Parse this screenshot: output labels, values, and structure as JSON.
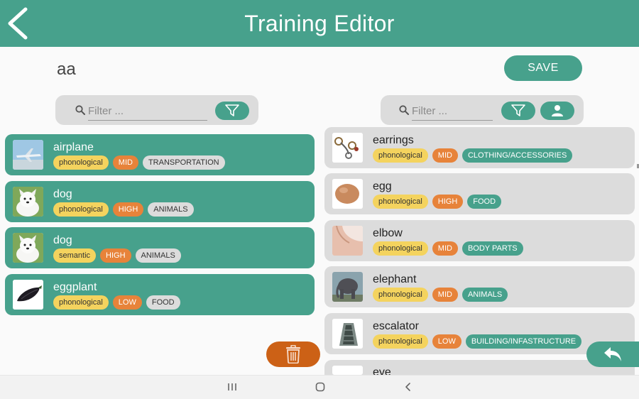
{
  "theme": {
    "teal": "#47a18c",
    "yellow": "#f4d35e",
    "orange": "#e7833a",
    "trash": "#cc6116"
  },
  "header": {
    "title": "Training Editor",
    "back_icon": "chevron-left-icon"
  },
  "training": {
    "name": "aa"
  },
  "toolbar": {
    "save_label": "SAVE"
  },
  "left_panel": {
    "filter_placeholder": "Filter ...",
    "items": [
      {
        "word": "airplane",
        "type": "phonological",
        "level": "MID",
        "category": "TRANSPORTATION"
      },
      {
        "word": "dog",
        "type": "phonological",
        "level": "HIGH",
        "category": "ANIMALS"
      },
      {
        "word": "dog",
        "type": "semantic",
        "level": "HIGH",
        "category": "ANIMALS"
      },
      {
        "word": "eggplant",
        "type": "phonological",
        "level": "LOW",
        "category": "FOOD"
      }
    ]
  },
  "right_panel": {
    "filter_placeholder": "Filter ...",
    "items": [
      {
        "word": "earrings",
        "type": "phonological",
        "level": "MID",
        "category": "CLOTHING/ACCESSORIES"
      },
      {
        "word": "egg",
        "type": "phonological",
        "level": "HIGH",
        "category": "FOOD"
      },
      {
        "word": "elbow",
        "type": "phonological",
        "level": "MID",
        "category": "BODY PARTS"
      },
      {
        "word": "elephant",
        "type": "phonological",
        "level": "MID",
        "category": "ANIMALS"
      },
      {
        "word": "escalator",
        "type": "phonological",
        "level": "LOW",
        "category": "BUILDING/INFASTRUCTURE"
      },
      {
        "word": "eye",
        "type": "",
        "level": "",
        "category": ""
      }
    ]
  },
  "icons": {
    "filter": "funnel-icon",
    "user": "person-icon",
    "search": "magnifier-icon",
    "trash": "trash-icon",
    "undo": "reply-arrow-icon",
    "nav_recent": "recent-apps-icon",
    "nav_home": "home-icon",
    "nav_back": "nav-back-icon"
  }
}
